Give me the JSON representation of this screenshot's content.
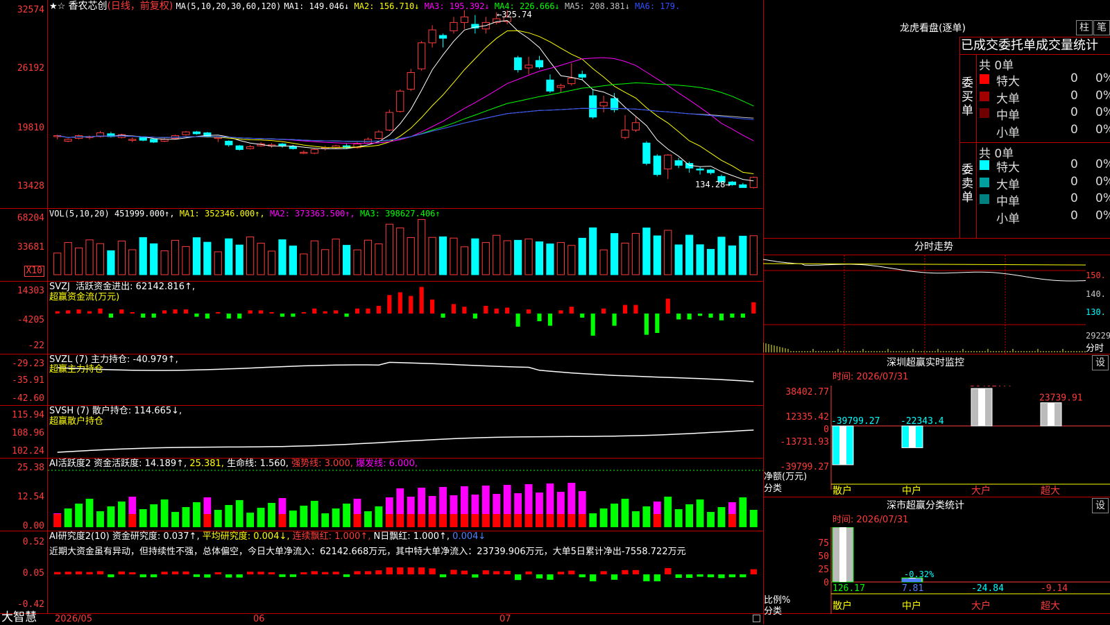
{
  "stock": {
    "name": "香农芯创",
    "mode": "(日线，前复权)",
    "ma_label": "MA(5,10,20,30,60,120)",
    "ma_values": [
      {
        "label": "MA1:",
        "value": "149.046↓",
        "color": "#ffffff"
      },
      {
        "label": "MA2:",
        "value": "156.710↓",
        "color": "#ffff00"
      },
      {
        "label": "MA3:",
        "value": "195.392↓",
        "color": "#ff00ff"
      },
      {
        "label": "MA4:",
        "value": "226.666↓",
        "color": "#00ff00"
      },
      {
        "label": "MA5:",
        "value": "208.381↓",
        "color": "#c0c0c0"
      },
      {
        "label": "MA6:",
        "value": "179.",
        "color": "#3050ff"
      }
    ],
    "high_label": "325.74",
    "low_label": "134.28"
  },
  "axis": {
    "price_ticks": [
      "32574",
      "26192",
      "19810",
      "13428"
    ],
    "vol_ticks": [
      "68204",
      "33681"
    ],
    "vol_unit": "X10",
    "svzj_ticks": [
      "14303",
      "-4205",
      "-22"
    ],
    "svzl_ticks": [
      "-29.23",
      "-35.91",
      "-42.60"
    ],
    "svsh_ticks": [
      "115.94",
      "108.96",
      "102.24"
    ],
    "ai_ticks": [
      "25.38",
      "12.54",
      "0.00"
    ],
    "ai2_ticks": [
      "0.52",
      "0.05",
      "-0.42"
    ]
  },
  "indicators": {
    "vol": {
      "name": "VOL(5,10,20)",
      "value": "451999.000↑,",
      "ma1": "MA1: 352346.000↑,",
      "ma2": "MA2: 373363.500↑,",
      "ma3": "MA3: 398627.406↑"
    },
    "svzj": {
      "name": "SVZJ",
      "label": "活跃资金进出: 62142.816↑,",
      "sub": "超赢资金流(万元)"
    },
    "svzl": {
      "name": "SVZL (7)",
      "label": "主力持仓: -40.979↑,",
      "sub": "超赢主力持仓"
    },
    "svsh": {
      "name": "SVSH (7)",
      "label": "散户持仓: 114.665↓,",
      "sub": "超赢散户持仓"
    },
    "ai1": {
      "name": "AI活跃度2",
      "label": "资金活跃度: 14.189↑,",
      "v2": "25.381,",
      "v3": "生命线: 1.560,",
      "v4": "强势线: 3.000,",
      "v5": "爆发线: 6.000,"
    },
    "ai2": {
      "name": "AI研究度2(10)",
      "label": "资金研究度: 0.037↑,",
      "v2": "平均研究度: 0.004↓,",
      "v3": "连续飘红: 1.000↑,",
      "v4": "N日飘红: 1.000↑,",
      "v5": "0.004↓"
    },
    "comment": "近期大资金虽有异动，但持续性不强，总体偏空，今日大单净流入：62142.668万元，其中特大单净流入：23739.906万元，大单5日累计净出-7558.722万元"
  },
  "dates": {
    "d1": "2026/05",
    "d2": "06",
    "d3": "07"
  },
  "brand": "大智慧",
  "right": {
    "dragon_title": "龙虎看盘(逐单)",
    "btn1": "柱",
    "btn2": "笔",
    "order_title": "已成交委托单成交量统计",
    "buy_label": "委买单",
    "sell_label": "委卖单",
    "buy_total": "共 0单",
    "sell_total": "共 0单",
    "buy_rows": [
      {
        "name": "特大",
        "count": "0",
        "pct": "0%",
        "color": "#ff0000"
      },
      {
        "name": "大单",
        "count": "0",
        "pct": "0%",
        "color": "#a00000"
      },
      {
        "name": "中单",
        "count": "0",
        "pct": "0%",
        "color": "#700000"
      },
      {
        "name": "小单",
        "count": "0",
        "pct": "0%",
        "color": "#000000"
      }
    ],
    "sell_rows": [
      {
        "name": "特大",
        "count": "0",
        "pct": "0%",
        "color": "#00ffff"
      },
      {
        "name": "大单",
        "count": "0",
        "pct": "0%",
        "color": "#00a0a0"
      },
      {
        "name": "中单",
        "count": "0",
        "pct": "0%",
        "color": "#008080"
      },
      {
        "name": "小单",
        "count": "0",
        "pct": "0%",
        "color": "#000000"
      }
    ],
    "intraday_title": "分时走势",
    "intraday_ticks": [
      "150.",
      "140.",
      "130.",
      "29229"
    ],
    "intraday_unit": "分时",
    "monitor_title": "深圳超赢实时监控",
    "monitor_set": "设",
    "monitor_time": "时间: 2026/07/31",
    "monitor_ticks": [
      "38402.77",
      "12335.42",
      "0",
      "-13731.93",
      "-39799.27"
    ],
    "monitor_axis_label1": "净额(万元)",
    "monitor_axis_label2": "分类",
    "monitor_bars": [
      {
        "cat": "散户",
        "value": -39799.27,
        "label": "-39799.27",
        "catcolor": "#ffff00"
      },
      {
        "cat": "中户",
        "value": -22343.4,
        "label": "-22343.4",
        "catcolor": "#ffff00"
      },
      {
        "cat": "大户",
        "value": 38402.77,
        "label": "38402.77",
        "catcolor": "#ff3c3c"
      },
      {
        "cat": "超大",
        "value": 23739.91,
        "label": "23739.91",
        "catcolor": "#ff3c3c"
      }
    ],
    "class_title": "深市超赢分类统计",
    "class_set": "设",
    "class_time": "时间: 2026/07/31",
    "class_ticks": [
      "75",
      "50",
      "25",
      "0"
    ],
    "class_axis_label1": "比例%",
    "class_axis_label2": "分类",
    "class_bars": [
      {
        "cat": "散户",
        "value": 126.17,
        "label": "126.17",
        "vcolor": "#00ff00"
      },
      {
        "cat": "中户",
        "value": 7.81,
        "label": "7.81",
        "vcolor": "#5080ff"
      },
      {
        "cat": "大户",
        "value": -24.84,
        "label": "-24.84",
        "vcolor": "#00ffff"
      },
      {
        "cat": "超大",
        "value": -9.14,
        "label": "-9.14",
        "vcolor": "#ff3c3c"
      }
    ],
    "class_note": "-0.32%"
  },
  "chart_data": {
    "type": "candlestick",
    "dates_axis": [
      "2026/05",
      "06",
      "07"
    ],
    "ylim": [
      134.28,
      325.74
    ],
    "ohlc": [
      [
        189,
        190,
        186,
        191
      ],
      [
        184,
        186,
        183,
        187
      ],
      [
        187,
        190,
        186,
        191
      ],
      [
        188,
        189,
        186,
        190
      ],
      [
        189,
        193,
        188,
        195
      ],
      [
        192,
        189,
        188,
        194
      ],
      [
        188,
        191,
        187,
        192
      ],
      [
        186,
        186,
        183,
        188
      ],
      [
        188,
        185,
        184,
        189
      ],
      [
        186,
        183,
        182,
        187
      ],
      [
        184,
        186,
        183,
        188
      ],
      [
        187,
        190,
        186,
        191
      ],
      [
        191,
        194,
        190,
        195
      ],
      [
        194,
        192,
        191,
        195
      ],
      [
        193,
        189,
        188,
        194
      ],
      [
        188,
        188,
        183,
        189
      ],
      [
        184,
        180,
        178,
        185
      ],
      [
        179,
        175,
        174,
        180
      ],
      [
        176,
        178,
        175,
        180
      ],
      [
        179,
        181,
        178,
        183
      ],
      [
        180,
        180,
        177,
        182
      ],
      [
        181,
        179,
        177,
        182
      ],
      [
        178,
        176,
        175,
        180
      ],
      [
        172,
        172,
        170,
        174
      ],
      [
        171,
        175,
        170,
        176
      ],
      [
        176,
        177,
        174,
        179
      ],
      [
        177,
        179,
        176,
        180
      ],
      [
        179,
        177,
        176,
        181
      ],
      [
        177,
        181,
        176,
        183
      ],
      [
        182,
        186,
        181,
        188
      ],
      [
        187,
        194,
        186,
        196
      ],
      [
        196,
        215,
        195,
        218
      ],
      [
        216,
        238,
        215,
        240
      ],
      [
        240,
        258,
        238,
        262
      ],
      [
        262,
        290,
        260,
        292
      ],
      [
        290,
        304,
        285,
        309
      ],
      [
        298,
        295,
        285,
        300
      ],
      [
        303,
        312,
        300,
        318
      ],
      [
        312,
        318,
        305,
        325
      ],
      [
        310,
        306,
        300,
        320
      ],
      [
        305,
        312,
        300,
        318
      ],
      [
        312,
        316,
        310,
        323
      ],
      [
        313,
        318,
        310,
        325
      ],
      [
        274,
        261,
        258,
        276
      ],
      [
        263,
        266,
        256,
        275
      ],
      [
        271,
        264,
        262,
        276
      ],
      [
        250,
        238,
        236,
        256
      ],
      [
        242,
        244,
        236,
        246
      ],
      [
        246,
        252,
        244,
        268
      ],
      [
        256,
        253,
        250,
        260
      ],
      [
        233,
        210,
        208,
        240
      ],
      [
        222,
        226,
        215,
        233
      ],
      [
        230,
        218,
        215,
        236
      ],
      [
        188,
        196,
        186,
        212
      ],
      [
        196,
        204,
        194,
        210
      ],
      [
        182,
        160,
        158,
        184
      ],
      [
        168,
        148,
        146,
        170
      ],
      [
        154,
        169,
        143,
        170
      ],
      [
        163,
        158,
        155,
        166
      ],
      [
        160,
        155,
        150,
        162
      ],
      [
        154,
        153,
        148,
        156
      ],
      [
        153,
        150,
        148,
        154
      ],
      [
        146,
        140,
        138,
        148
      ],
      [
        140,
        137,
        136,
        141
      ],
      [
        137,
        134,
        134,
        139
      ],
      [
        134,
        145,
        133,
        146
      ]
    ],
    "volume_unit": "X10",
    "vol_ylim": [
      0,
      68204
    ]
  }
}
